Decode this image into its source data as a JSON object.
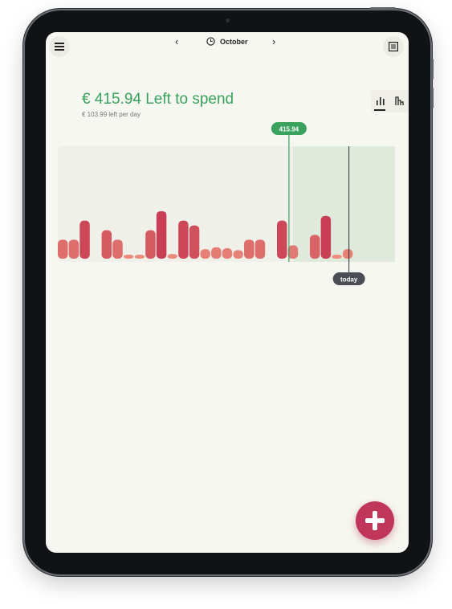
{
  "header": {
    "prev_label": "‹",
    "next_label": "›",
    "month": "October",
    "menu_icon": "hamburger-menu-icon",
    "calendar_icon": "clock-icon",
    "list_icon": "list-view-icon"
  },
  "summary": {
    "left_to_spend": "€ 415.94 Left to spend",
    "per_day": "€ 103.99 left per day",
    "accent_color": "#3aa25c"
  },
  "view_toggle": {
    "bar_icon": "bar-chart-icon",
    "line_icon": "cumulative-chart-icon",
    "active": "bar"
  },
  "chart": {
    "budget_marker_label": "415.94",
    "today_label": "today"
  },
  "chart_data": {
    "type": "bar",
    "values": [
      2,
      2,
      4,
      0,
      3,
      2,
      0.4,
      0.2,
      3,
      5,
      0.5,
      4,
      3.5,
      1,
      1.2,
      1.1,
      0.9,
      2,
      2,
      0,
      4,
      1.4,
      0,
      2.5,
      4.5,
      0.4,
      1
    ],
    "ylim": [
      0,
      5.5
    ],
    "budget_marker_index": 21,
    "today_index": 26
  },
  "fab": {
    "icon": "plus-icon"
  }
}
